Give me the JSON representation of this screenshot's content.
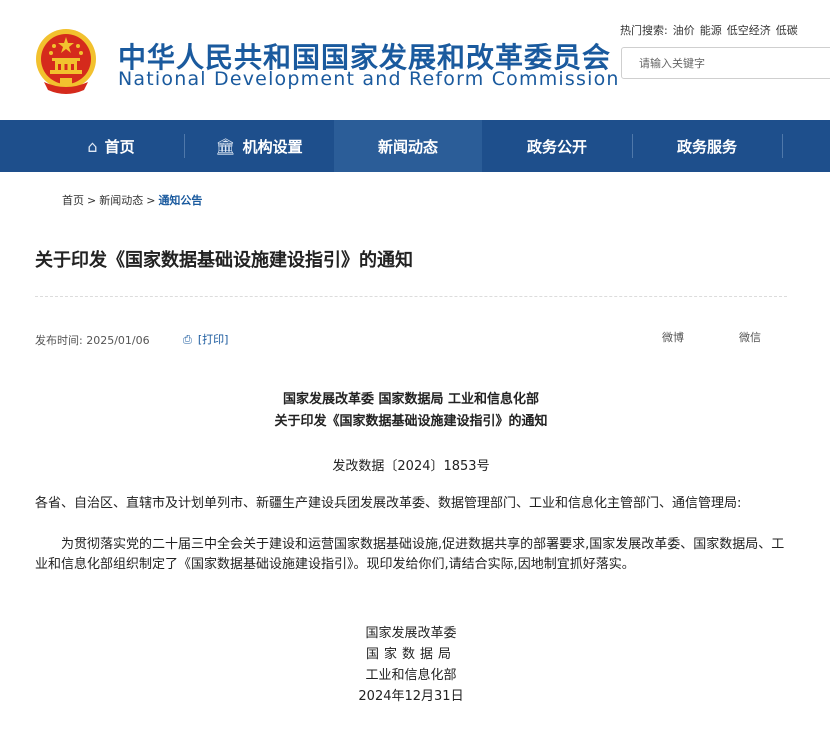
{
  "header": {
    "title_cn": "中华人民共和国国家发展和改革委员会",
    "title_en": "National Development and Reform Commission",
    "hot_search_label": "热门搜索:",
    "hot_search_terms": [
      "油价",
      "能源",
      "低空经济",
      "低碳"
    ],
    "search_placeholder": "请输入关键字"
  },
  "nav": {
    "items": [
      {
        "label": "首页",
        "icon": "home-icon"
      },
      {
        "label": "机构设置",
        "icon": "institution-icon"
      },
      {
        "label": "新闻动态"
      },
      {
        "label": "政务公开"
      },
      {
        "label": "政务服务"
      }
    ],
    "active_index": 2
  },
  "breadcrumb": {
    "items": [
      "首页",
      "新闻动态",
      "通知公告"
    ],
    "separator": ">"
  },
  "article": {
    "title": "关于印发《国家数据基础设施建设指引》的通知",
    "publish_label": "发布时间:",
    "publish_date": "2025/01/06",
    "print_label": "[打印]",
    "share_weibo": "微博",
    "share_wechat": "微信",
    "issuers": "国家发展改革委 国家数据局 工业和信息化部",
    "subtitle": "关于印发《国家数据基础设施建设指引》的通知",
    "doc_number": "发改数据〔2024〕1853号",
    "salutation": "各省、自治区、直辖市及计划单列市、新疆生产建设兵团发展改革委、数据管理部门、工业和信息化主管部门、通信管理局:",
    "body": "为贯彻落实党的二十届三中全会关于建设和运营国家数据基础设施,促进数据共享的部署要求,国家发展改革委、国家数据局、工业和信息化部组织制定了《国家数据基础设施建设指引》。现印发给你们,请结合实际,因地制宜抓好落实。",
    "signatures": [
      "国家发展改革委",
      "国家数据局",
      "工业和信息化部"
    ],
    "sign_date": "2024年12月31日"
  },
  "colors": {
    "brand_blue": "#1a5a9e",
    "nav_bg": "#1e4f8c",
    "nav_active_bg": "#2b5d98",
    "emblem_red": "#d52a1c",
    "emblem_gold": "#f2c12e"
  }
}
